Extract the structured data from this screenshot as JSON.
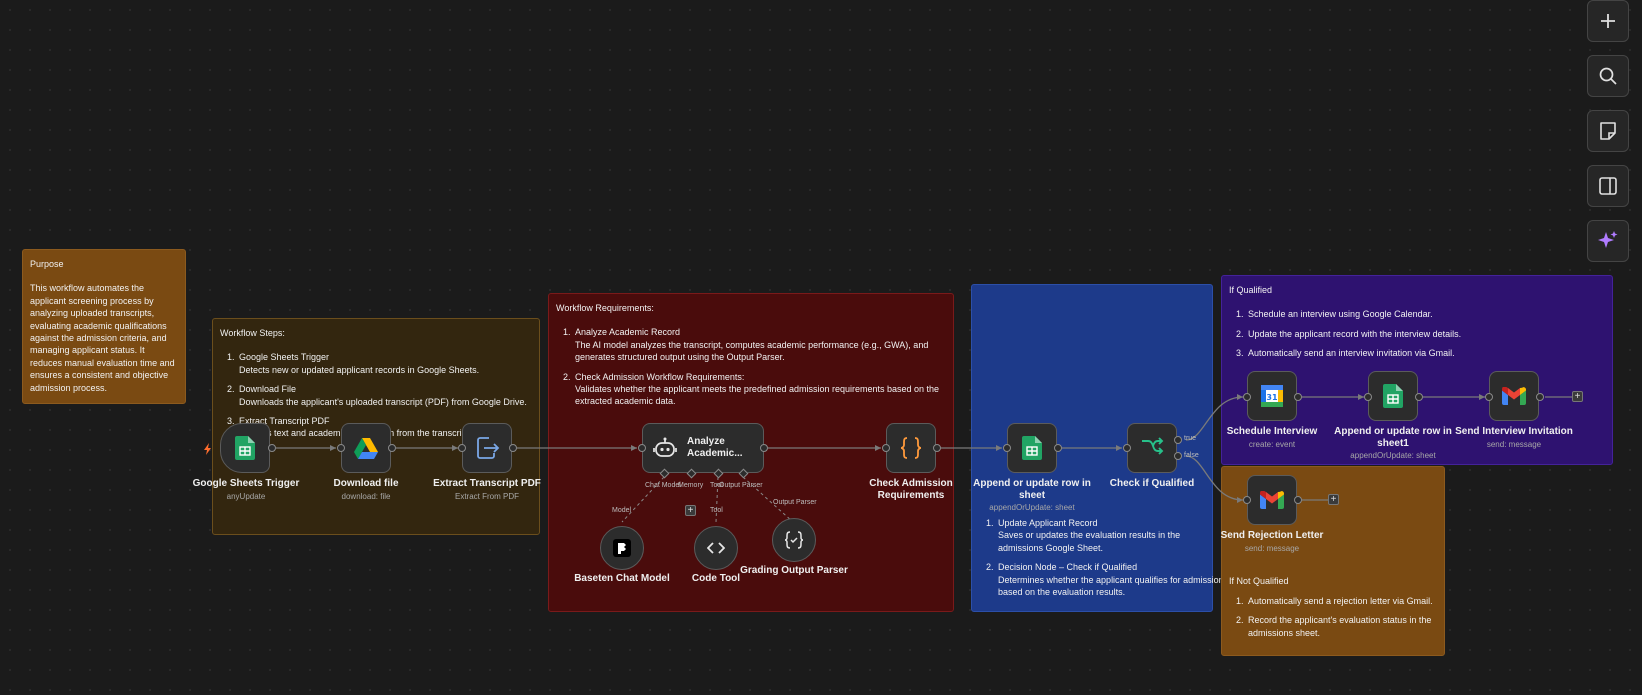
{
  "notes": {
    "purpose": {
      "title": "Purpose",
      "body": "This workflow automates the applicant screening process by analyzing uploaded transcripts, evaluating academic qualifications against the admission criteria, and managing applicant status. It reduces manual evaluation time and ensures a consistent and objective admission process.",
      "color": "#7a4a12"
    },
    "workflow_steps": {
      "title": "Workflow Steps:",
      "items": [
        {
          "head": "Google Sheets Trigger",
          "desc": "Detects new or updated applicant records in Google Sheets."
        },
        {
          "head": "Download File",
          "desc": "Downloads the applicant's uploaded transcript (PDF) from Google Drive."
        },
        {
          "head": "Extract Transcript PDF",
          "desc": "Extracts text and academic information from the transcript."
        }
      ],
      "color": "#33260f"
    },
    "workflow_requirements": {
      "title": "Workflow Requirements:",
      "items": [
        {
          "head": "Analyze Academic Record",
          "desc": "The AI model analyzes the transcript, computes academic performance (e.g., GWA), and generates structured output using the Output Parser."
        },
        {
          "head": "Check Admission Workflow Requirements:",
          "desc": "Validates whether the applicant meets the predefined admission requirements based on the extracted academic data."
        }
      ],
      "color": "#4a0c0c"
    },
    "blue_note": {
      "items": [
        {
          "head": "Update Applicant Record",
          "desc": "Saves or updates the evaluation results in the admissions Google Sheet."
        },
        {
          "head": "Decision Node – Check if Qualified",
          "desc": "Determines whether the applicant qualifies for admission based on the evaluation results."
        }
      ],
      "color": "#1d3a8a"
    },
    "if_qualified": {
      "title": "If Qualified",
      "items": [
        {
          "head": "Schedule an interview using Google Calendar."
        },
        {
          "head": "Update the applicant record with the interview details."
        },
        {
          "head": "Automatically send an interview invitation via Gmail."
        }
      ],
      "color": "#2e1270"
    },
    "if_not_qualified": {
      "title": "If Not Qualified",
      "items": [
        {
          "head": "Automatically send a rejection letter via Gmail."
        },
        {
          "head": "Record the applicant's evaluation status in the admissions sheet."
        }
      ],
      "color": "#7a4a12"
    }
  },
  "nodes": {
    "sheets_trigger": {
      "label": "Google Sheets Trigger",
      "sub": "anyUpdate",
      "icon": "google-sheets-icon"
    },
    "download_file": {
      "label": "Download file",
      "sub": "download: file",
      "icon": "google-drive-icon"
    },
    "extract_pdf": {
      "label": "Extract Transcript PDF",
      "sub": "Extract From PDF",
      "icon": "extract-file-icon"
    },
    "analyze": {
      "label": "Analyze Academic...",
      "icon": "ai-agent-robot-icon"
    },
    "check_admission": {
      "label": "Check Admission Requirements",
      "icon": "code-braces-icon"
    },
    "append_row": {
      "label": "Append or update row in sheet",
      "sub": "appendOrUpdate: sheet",
      "icon": "google-sheets-icon"
    },
    "check_qualified": {
      "label": "Check if Qualified",
      "icon": "if-branch-icon",
      "true_label": "true",
      "false_label": "false"
    },
    "schedule_interview": {
      "label": "Schedule Interview",
      "sub": "create: event",
      "icon": "google-calendar-icon"
    },
    "append_row1": {
      "label": "Append or update row in sheet1",
      "sub": "appendOrUpdate: sheet",
      "icon": "google-sheets-icon"
    },
    "send_invitation": {
      "label": "Send Interview Invitation",
      "sub": "send: message",
      "icon": "gmail-icon"
    },
    "send_rejection": {
      "label": "Send Rejection Letter",
      "sub": "send: message",
      "icon": "gmail-icon"
    },
    "baseten": {
      "label": "Baseten Chat Model",
      "icon": "baseten-icon"
    },
    "code_tool": {
      "label": "Code Tool",
      "icon": "code-tool-icon"
    },
    "grading_parser": {
      "label": "Grading Output Parser",
      "icon": "output-parser-icon"
    }
  },
  "sub_ports": {
    "chat_model": "Chat Model",
    "memory": "Memory",
    "tool": "Tool",
    "output_parser": "Output Parser",
    "model_tag": "Model",
    "tool_tag": "Tool",
    "parser_tag": "Output Parser"
  },
  "plus_glyph": "+",
  "sidebar": [
    "zoom-in-plus-icon",
    "search-icon",
    "sticky-note-icon",
    "panel-toggle-icon",
    "ai-sparkle-icon"
  ],
  "colors": {
    "canvas": "#1b1b1b",
    "node": "#2c2c2c",
    "edge": "#7a7a7a",
    "accent_orange": "#ff6d2d",
    "sparkle": "#b07cff"
  }
}
